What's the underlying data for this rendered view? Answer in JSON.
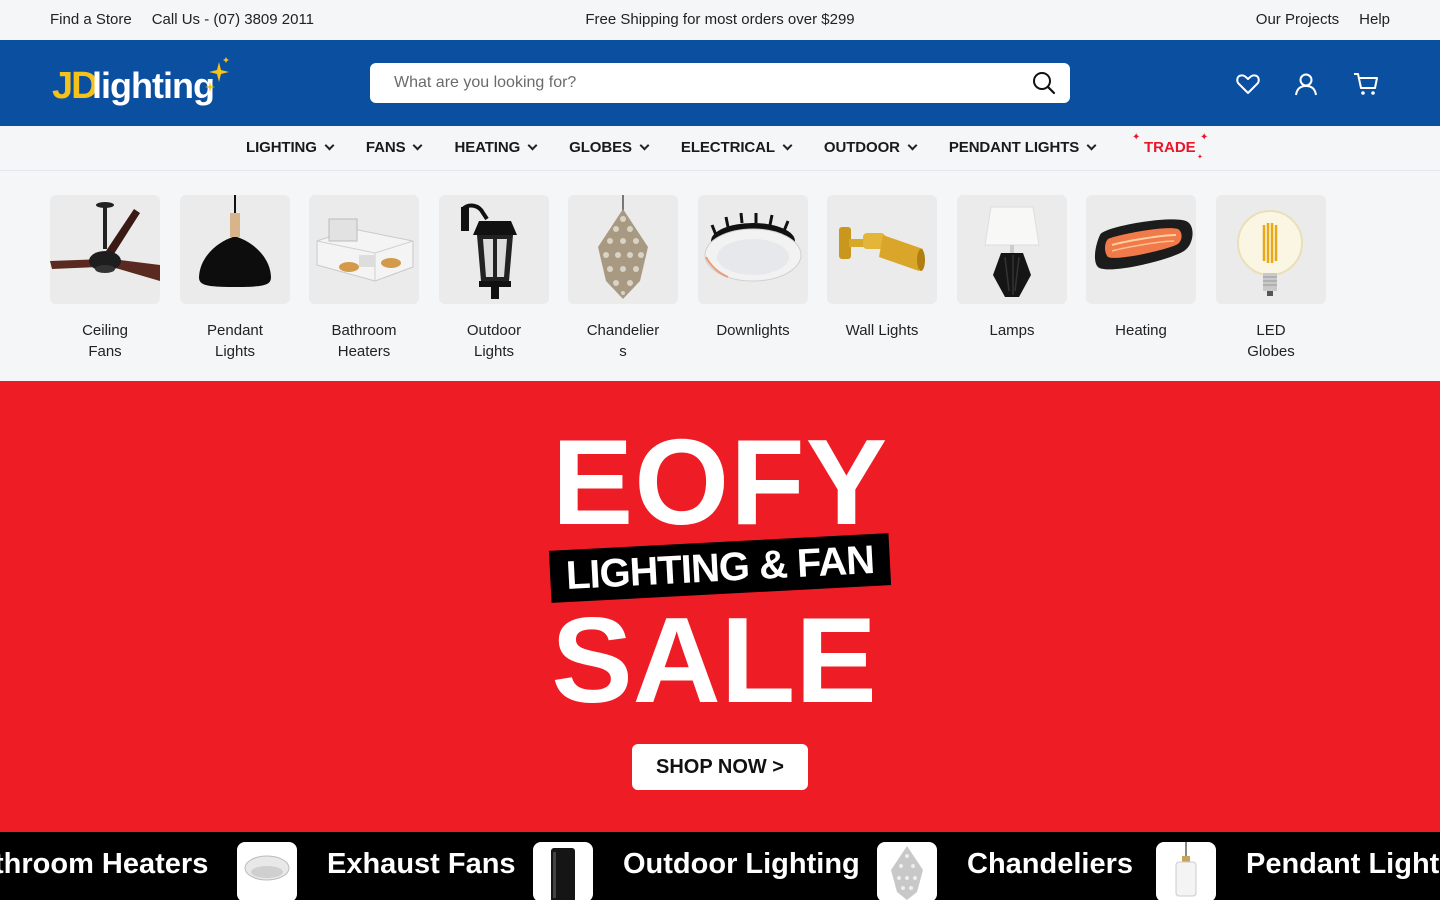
{
  "utility": {
    "find_store": "Find a Store",
    "call_us": "Call Us - (07) 3809 2011",
    "promo": "Free Shipping for most orders over $299",
    "projects": "Our Projects",
    "help": "Help"
  },
  "header": {
    "logo_text_jd": "JD",
    "logo_text_lighting": "lighting",
    "search_placeholder": "What are you looking for?",
    "icons": [
      "search-icon",
      "heart-icon",
      "user-icon",
      "cart-icon"
    ],
    "brand_color": "#0b4fa0",
    "logo_yellow": "#f5c21b"
  },
  "nav": {
    "items": [
      "LIGHTING",
      "FANS",
      "HEATING",
      "GLOBES",
      "ELECTRICAL",
      "OUTDOOR",
      "PENDANT LIGHTS"
    ],
    "trade": "TRADE",
    "trade_color": "#e8162a"
  },
  "categories": [
    {
      "label": "Ceiling Fans",
      "icon": "ceiling-fan-image"
    },
    {
      "label": "Pendant Lights",
      "icon": "pendant-light-image"
    },
    {
      "label": "Bathroom Heaters",
      "icon": "bathroom-heater-image"
    },
    {
      "label": "Outdoor Lights",
      "icon": "outdoor-light-image"
    },
    {
      "label": "Chandeliers",
      "icon": "chandelier-image"
    },
    {
      "label": "Downlights",
      "icon": "downlight-image"
    },
    {
      "label": "Wall Lights",
      "icon": "wall-light-image"
    },
    {
      "label": "Lamps",
      "icon": "lamp-image"
    },
    {
      "label": "Heating",
      "icon": "heater-image"
    },
    {
      "label": "LED Globes",
      "icon": "led-globe-image"
    }
  ],
  "hero": {
    "line1": "EOFY",
    "tag": "LIGHTING & FAN",
    "line2": "SALE",
    "cta": "SHOP NOW >",
    "bg_color": "#ee1c25"
  },
  "marquee": {
    "items": [
      "throom Heaters",
      "Exhaust Fans",
      "Outdoor Lighting",
      "Chandeliers",
      "Pendant Lights"
    ]
  }
}
